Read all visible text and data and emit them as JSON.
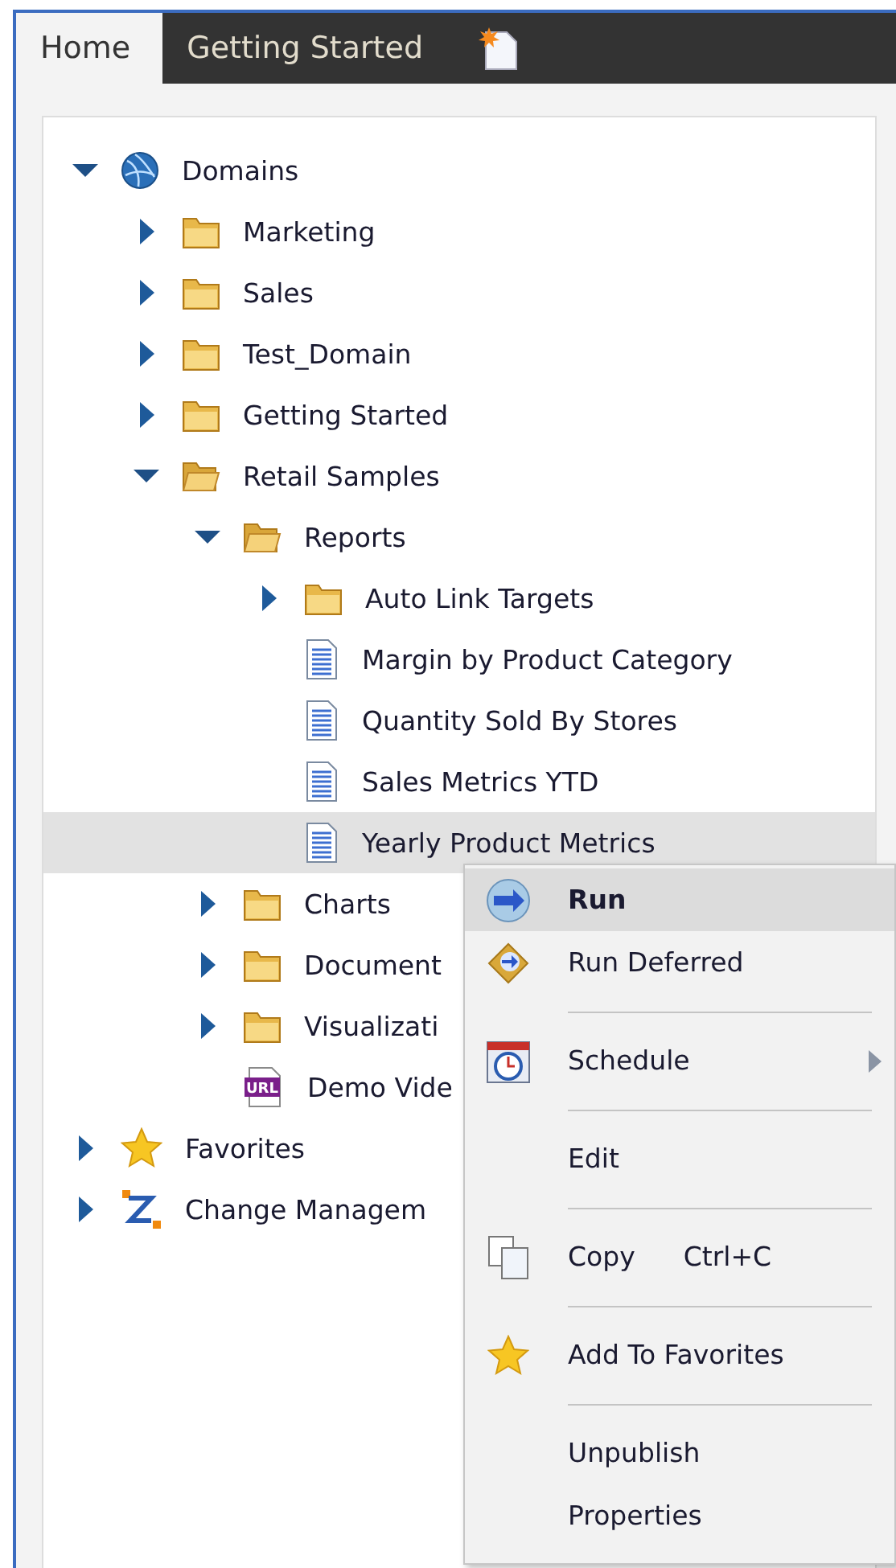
{
  "tabs": [
    {
      "label": "Home",
      "selected": true
    },
    {
      "label": "Getting Started",
      "selected": false
    }
  ],
  "tree": [
    {
      "label": "Domains",
      "kind": "globe",
      "expanded": true,
      "selected": false,
      "children": [
        {
          "label": "Marketing",
          "kind": "folder",
          "expanded": false,
          "selected": false
        },
        {
          "label": "Sales",
          "kind": "folder",
          "expanded": false,
          "selected": false
        },
        {
          "label": "Test_Domain",
          "kind": "folder",
          "expanded": false,
          "selected": false
        },
        {
          "label": "Getting Started",
          "kind": "folder",
          "expanded": false,
          "selected": false
        },
        {
          "label": "Retail Samples",
          "kind": "folder",
          "expanded": true,
          "selected": false,
          "children": [
            {
              "label": "Reports",
              "kind": "folder",
              "expanded": true,
              "selected": false,
              "children": [
                {
                  "label": "Auto Link Targets",
                  "kind": "folder",
                  "expanded": false,
                  "selected": false
                },
                {
                  "label": "Margin by Product Category",
                  "kind": "report",
                  "selected": false
                },
                {
                  "label": "Quantity Sold By Stores",
                  "kind": "report",
                  "selected": false
                },
                {
                  "label": "Sales Metrics YTD",
                  "kind": "report",
                  "selected": false
                },
                {
                  "label": "Yearly Product Metrics",
                  "kind": "report",
                  "selected": true
                }
              ]
            },
            {
              "label": "Charts",
              "kind": "folder",
              "expanded": false,
              "selected": false
            },
            {
              "label": "Document",
              "kind": "folder",
              "expanded": false,
              "selected": false
            },
            {
              "label": "Visualizati",
              "kind": "folder",
              "expanded": false,
              "selected": false
            },
            {
              "label": "Demo Vide",
              "kind": "url",
              "badge": "URL",
              "selected": false
            }
          ]
        }
      ]
    },
    {
      "label": "Favorites",
      "kind": "star",
      "expanded": false,
      "selected": false
    },
    {
      "label": "Change Managem",
      "kind": "change",
      "expanded": false,
      "selected": false
    }
  ],
  "context_menu": [
    {
      "kind": "run",
      "label": "Run",
      "default": true,
      "selected": true
    },
    {
      "kind": "deferred",
      "label": "Run Deferred",
      "default": false,
      "selected": false
    },
    {
      "kind": "separator"
    },
    {
      "kind": "schedule",
      "label": "Schedule",
      "submenu": true,
      "default": false,
      "selected": false
    },
    {
      "kind": "separator"
    },
    {
      "kind": "plain",
      "label": "Edit",
      "default": false,
      "selected": false
    },
    {
      "kind": "separator"
    },
    {
      "kind": "copy",
      "label": "Copy",
      "shortcut": "Ctrl+C",
      "default": false,
      "selected": false
    },
    {
      "kind": "separator"
    },
    {
      "kind": "favorite",
      "label": "Add To Favorites",
      "default": false,
      "selected": false
    },
    {
      "kind": "separator"
    },
    {
      "kind": "plain",
      "label": "Unpublish",
      "default": false,
      "selected": false
    },
    {
      "kind": "plain",
      "label": "Properties",
      "default": false,
      "selected": false
    }
  ]
}
